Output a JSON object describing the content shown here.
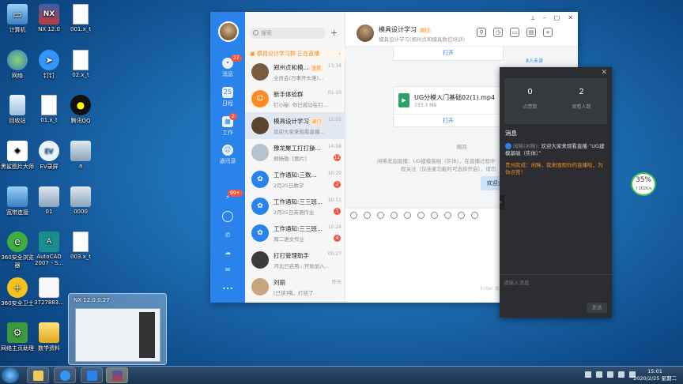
{
  "desktop": {
    "icons": [
      {
        "label": "计算机"
      },
      {
        "label": "NX 12.0"
      },
      {
        "label": "001.x_t"
      },
      {
        "label": "网络"
      },
      {
        "label": "钉钉"
      },
      {
        "label": "02.x_t"
      },
      {
        "label": "回收站"
      },
      {
        "label": "01.x_t"
      },
      {
        "label": "腾讯QQ"
      },
      {
        "label": "黑鲨图片大师"
      },
      {
        "label": "EV录屏"
      },
      {
        "label": "a"
      },
      {
        "label": "宽带连接"
      },
      {
        "label": "01"
      },
      {
        "label": "0000"
      },
      {
        "label": "360安全浏览器"
      },
      {
        "label": "AutoCAD 2007 - S..."
      },
      {
        "label": "003.x_t"
      },
      {
        "label": "360安全卫士"
      },
      {
        "label": "3727883..."
      },
      {
        "label": "网络主页助理"
      },
      {
        "label": "数学资料"
      }
    ]
  },
  "dingtalk": {
    "nav": {
      "messages_label": "消息",
      "messages_badge": "27",
      "calendar_label": "日程",
      "calendar_day": "25",
      "work_label": "工作",
      "work_badge": "2",
      "contacts_label": "通讯录",
      "more_badge": "99+"
    },
    "search_placeholder": "搜索",
    "live_notice": "模具设计学习群 正在直播",
    "conversations": [
      {
        "name": "郑州贞和模...",
        "tag": "全员",
        "msg": "全员会(万事开头难)...",
        "time": "13:34"
      },
      {
        "name": "新手体验群",
        "msg": "钉小秘: 你已成功在钉...",
        "time": "02-10"
      },
      {
        "name": "模具设计学习",
        "tag": "部门",
        "msg": "欢迎大家来观看直播...",
        "time": "15:01"
      },
      {
        "name": "豫龙聚工打打操...",
        "msg": "郑杨微: [图片]",
        "time": "14:58",
        "badge": "12"
      },
      {
        "name": "工作通知:三数...",
        "msg": "2月25日数学",
        "time": "10:29",
        "badge": "2"
      },
      {
        "name": "工作通知:三三班...",
        "msg": "2月25日英语作业",
        "time": "10:51",
        "badge": "1"
      },
      {
        "name": "工作通知:三三班...",
        "msg": "周二语文作业",
        "time": "10:24",
        "badge": "4"
      },
      {
        "name": "打打管理助手",
        "msg": "河北已启用...开始加入...",
        "time": "09:27"
      },
      {
        "name": "刘丽",
        "msg": "[已读]哦，打扰了",
        "time": "昨天"
      }
    ],
    "chat": {
      "title": "模具设计学习",
      "title_tag": "部门",
      "subtitle": "模具设计学习(郑州贞和模具数控培训)",
      "top_open": "打开",
      "top_unread": "8人未读",
      "file_name": "UG分模入门基础02(1).mp4",
      "file_size": "333.3 MB",
      "file_open": "打开",
      "recall": "撤回",
      "system_text_1": "闲稀发起直播：UG建模基础（实体），在直播过程中",
      "system_text_2": "程关注（仅连麦功能时可选择开启），请勿",
      "self_msg": "欢迎大家来观看直播 “UG建模基础",
      "enter_hint": "Enter 发送，Ctrl+..."
    }
  },
  "live_panel": {
    "likes_value": "0",
    "likes_label": "点赞数",
    "viewers_value": "2",
    "viewers_label": "观看人数",
    "section_title": "消息",
    "msg1_who": "闲稀(闲稀):",
    "msg1_text": "欢迎大家来观看直播 “UG建模基础（实体）”",
    "msg2_text": "贵州民成：闲稀，我来围观你的直播啦，为你点赞！",
    "input_placeholder": "请输入消息",
    "send_label": "发送"
  },
  "net_widget": {
    "percent": "35%",
    "speed": "↑102K/s"
  },
  "thumbnail": {
    "title": "NX 12.0.0.27"
  },
  "taskbar": {
    "time": "15:01",
    "date": "2020/2/25 星期二"
  },
  "colors": {
    "dingtalk_blue": "#2a83ea",
    "badge_red": "#f25643",
    "live_orange": "#f08a24"
  }
}
